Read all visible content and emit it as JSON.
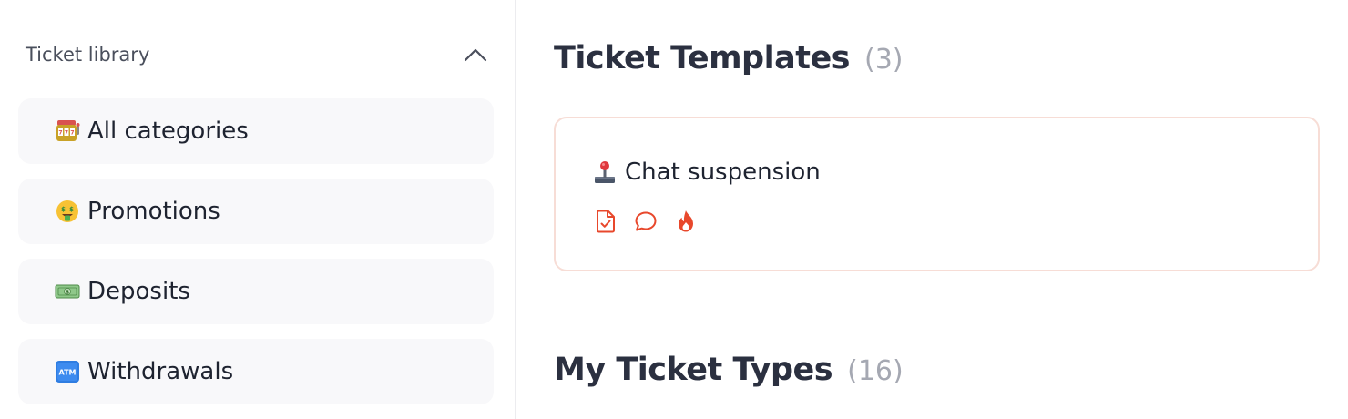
{
  "sidebar": {
    "title": "Ticket library",
    "collapse_icon": "chevron-up-icon",
    "categories": [
      {
        "label": "All categories",
        "icon": "slot-machine-icon"
      },
      {
        "label": "Promotions",
        "icon": "money-mouth-face-icon"
      },
      {
        "label": "Deposits",
        "icon": "dollar-banknote-icon"
      },
      {
        "label": "Withdrawals",
        "icon": "atm-sign-icon"
      }
    ]
  },
  "main": {
    "templates": {
      "title": "Ticket Templates",
      "count": "(3)",
      "cards": [
        {
          "title": "Chat suspension",
          "emoji_icon": "joystick-icon",
          "tag_icons": [
            "file-check-icon",
            "chat-bubble-icon",
            "flame-icon"
          ]
        }
      ]
    },
    "types": {
      "title": "My Ticket Types",
      "count": "(16)"
    }
  },
  "colors": {
    "accent": "#e8482c",
    "card_border": "#f7ddd6",
    "item_bg": "#f8f8fa",
    "muted_count": "#a5a8b2"
  }
}
